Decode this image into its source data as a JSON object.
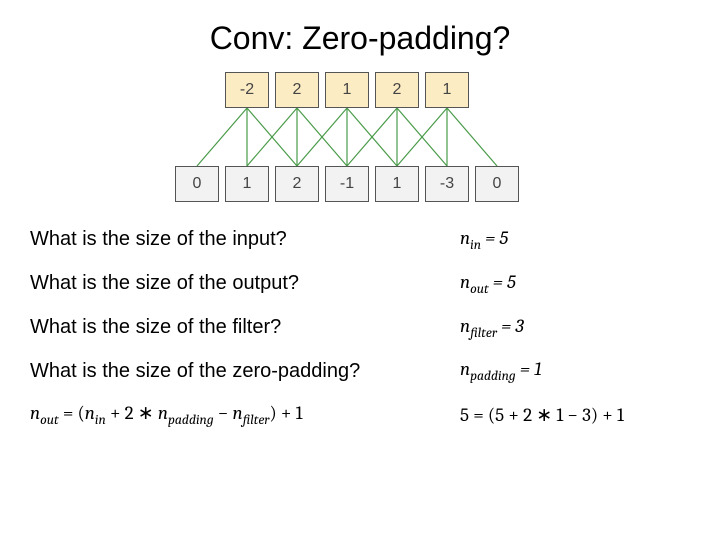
{
  "title": "Conv: Zero-padding?",
  "diagram": {
    "output": [
      "-2",
      "2",
      "1",
      "2",
      "1"
    ],
    "input": [
      "0",
      "1",
      "2",
      "-1",
      "1",
      "-3",
      "0"
    ]
  },
  "qa": [
    {
      "q": "What is the size of the input?",
      "var": "n",
      "sub": "in",
      "val": "5"
    },
    {
      "q": "What is the size of the output?",
      "var": "n",
      "sub": "out",
      "val": "5"
    },
    {
      "q": "What is the size of the filter?",
      "var": "n",
      "sub": "filter",
      "val": "3"
    },
    {
      "q": "What is the size of the zero-padding?",
      "var": "n",
      "sub": "padding",
      "val": "1"
    }
  ],
  "formula": {
    "lhs_var": "n",
    "lhs_sub": "out",
    "rhs_text": "(nin + 2 ∗ npadding − nfilter) + 1",
    "numeric": "5 = (5 + 2 ∗ 1 − 3) + 1"
  },
  "chart_data": {
    "type": "diagram",
    "output_nodes": [
      -2,
      2,
      1,
      2,
      1
    ],
    "input_nodes": [
      0,
      1,
      2,
      -1,
      1,
      -3,
      0
    ],
    "filter_size": 3,
    "padding": 1,
    "edges_description": "each output node i connects to input nodes i, i+1, i+2"
  }
}
